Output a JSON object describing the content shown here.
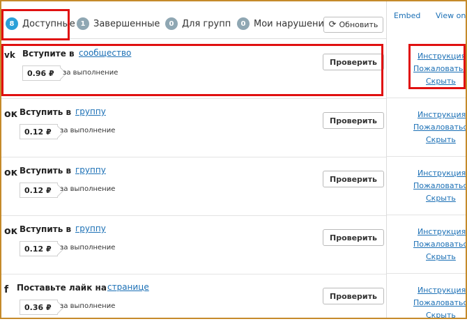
{
  "tabs": [
    {
      "count": "8",
      "label": "Доступные"
    },
    {
      "count": "1",
      "label": "Завершенные"
    },
    {
      "count": "0",
      "label": "Для групп"
    },
    {
      "count": "0",
      "label": "Мои нарушения"
    }
  ],
  "refresh_label": "Обновить",
  "side_header": {
    "embed": "Embed",
    "view_on": "View on T"
  },
  "tasks": [
    {
      "network_icon": "vk-icon",
      "icon_glyph": "vk",
      "title": "Вступите в",
      "link": "сообщество",
      "price": "0.96 ₽",
      "price_note": "за выполнение",
      "action": "Проверить"
    },
    {
      "network_icon": "ok-icon",
      "icon_glyph": "ок",
      "title": "Вступить в",
      "link": "группу",
      "price": "0.12 ₽",
      "price_note": "за выполнение",
      "action": "Проверить"
    },
    {
      "network_icon": "ok-icon",
      "icon_glyph": "ок",
      "title": "Вступить в",
      "link": "группу",
      "price": "0.12 ₽",
      "price_note": "за выполнение",
      "action": "Проверить"
    },
    {
      "network_icon": "ok-icon",
      "icon_glyph": "ок",
      "title": "Вступить в",
      "link": "группу",
      "price": "0.12 ₽",
      "price_note": "за выполнение",
      "action": "Проверить"
    },
    {
      "network_icon": "facebook-icon",
      "icon_glyph": "f",
      "title": "Поставьте лайк на",
      "link": "странице",
      "price": "0.36 ₽",
      "price_note": "за выполнение",
      "action": "Проверить"
    }
  ],
  "side_links": {
    "instruction": "Инструкция",
    "complain": "Пожаловаться",
    "hide": "Скрыть"
  },
  "colors": {
    "link": "#1a6fb5",
    "badge_active": "#2ba0d8",
    "badge": "#8fa7b3",
    "highlight": "#e01010",
    "frame": "#c58a2a"
  }
}
